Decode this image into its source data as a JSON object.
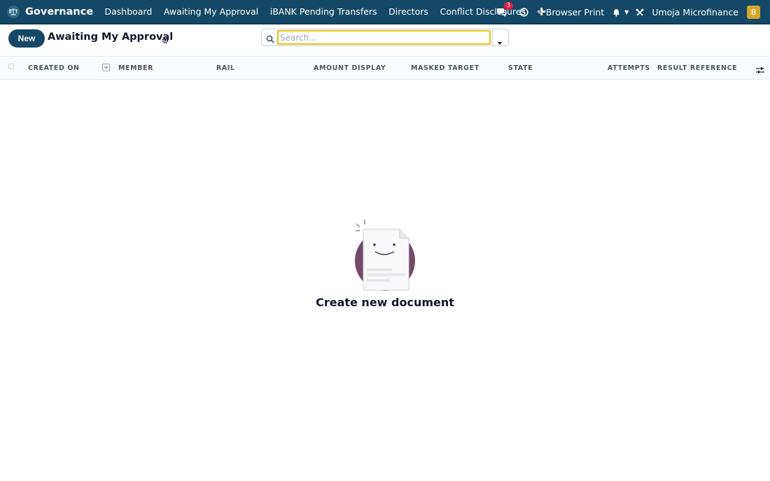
{
  "navbar": {
    "brand_icon": "balance-scale-icon",
    "brand": "Governance",
    "menu": [
      {
        "label": "Dashboard"
      },
      {
        "label": "Awaiting My Approval"
      },
      {
        "label": "iBANK Pending Transfers"
      },
      {
        "label": "Directors"
      },
      {
        "label": "Conflict Disclosures"
      }
    ],
    "add_icon": "plus-icon",
    "messages_badge": "3",
    "print_label": "Browser Print",
    "company": "Umoja Microfinance",
    "avatar_letter": "B",
    "colors": {
      "bar": "#144866",
      "avatar": "#d4a72c",
      "badge": "#e11d48"
    }
  },
  "control_panel": {
    "new_label": "New",
    "title": "Awaiting My Approval",
    "search_placeholder": "Search..."
  },
  "table": {
    "columns": [
      "CREATED ON",
      "MEMBER",
      "RAIL",
      "AMOUNT DISPLAY",
      "MASKED TARGET",
      "STATE",
      "ATTEMPTS",
      "RESULT REFERENCE"
    ]
  },
  "empty_state": {
    "title": "Create new document",
    "colors": {
      "circle": "#714b67"
    }
  }
}
